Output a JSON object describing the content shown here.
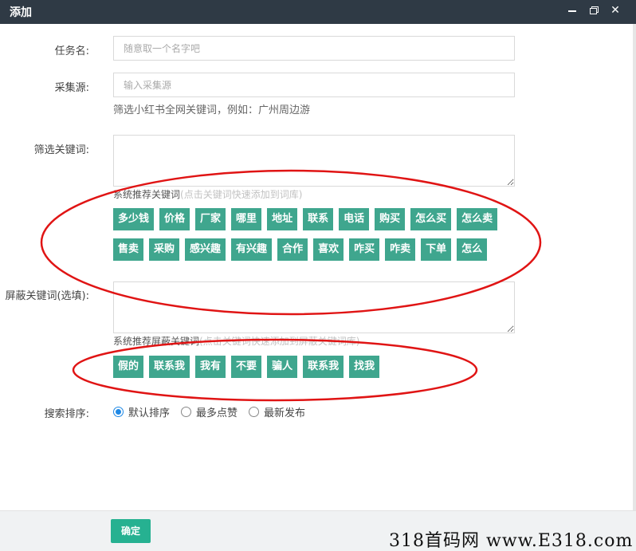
{
  "window": {
    "title": "添加"
  },
  "form": {
    "task_name": {
      "label": "任务名:",
      "placeholder": "随意取一个名字吧"
    },
    "source": {
      "label": "采集源:",
      "placeholder": "输入采集源",
      "hint": "筛选小红书全网关键词，例如：广州周边游"
    },
    "filter_keywords": {
      "label": "筛选关键词:",
      "recommend_title": "系统推荐关键词",
      "recommend_note": "(点击关键词快速添加到词库)",
      "tags": [
        "多少钱",
        "价格",
        "厂家",
        "哪里",
        "地址",
        "联系",
        "电话",
        "购买",
        "怎么买",
        "怎么卖",
        "售卖",
        "采购",
        "感兴趣",
        "有兴趣",
        "合作",
        "喜欢",
        "咋买",
        "咋卖",
        "下单",
        "怎么"
      ]
    },
    "block_keywords": {
      "label": "屏蔽关键词(选填):",
      "recommend_title": "系统推荐屏蔽关键词",
      "recommend_note": "(点击关键词快速添加到屏蔽关键词库)",
      "tags": [
        "假的",
        "联系我",
        "我有",
        "不要",
        "骗人",
        "联系我",
        "找我"
      ]
    },
    "sort": {
      "label": "搜索排序:",
      "options": [
        "默认排序",
        "最多点赞",
        "最新发布"
      ],
      "selected": "默认排序"
    }
  },
  "footer": {
    "ok_label": "确定",
    "watermark": "318首码网 www.E318.com"
  },
  "colors": {
    "titlebar": "#2f3a45",
    "tag": "#3fa68e",
    "ok_button": "#26b191",
    "annotation": "#e01414"
  }
}
